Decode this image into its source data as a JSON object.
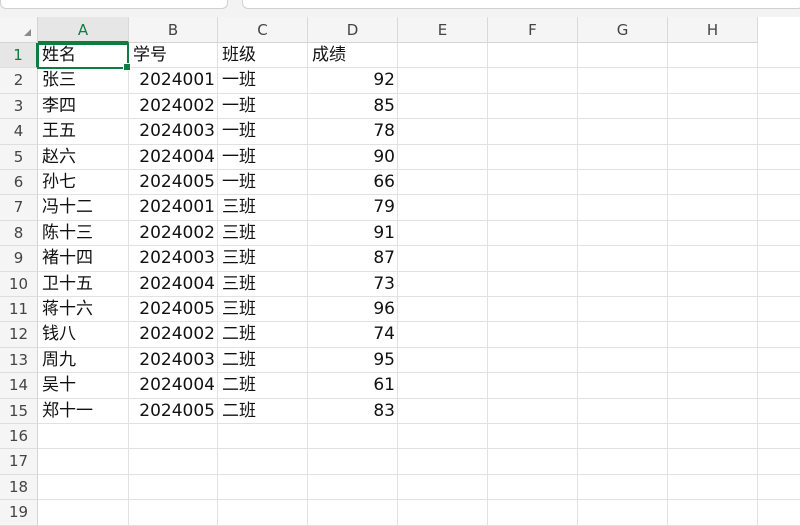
{
  "columns": [
    "A",
    "B",
    "C",
    "D",
    "E",
    "F",
    "G",
    "H"
  ],
  "rows": [
    "1",
    "2",
    "3",
    "4",
    "5",
    "6",
    "7",
    "8",
    "9",
    "10",
    "11",
    "12",
    "13",
    "14",
    "15",
    "16",
    "17",
    "18",
    "19"
  ],
  "selected_cell": "A1",
  "accent_color": "#107c41",
  "cells": [
    [
      "姓名",
      "学号",
      "班级",
      "成绩"
    ],
    [
      "张三",
      "2024001",
      "一班",
      "92"
    ],
    [
      "李四",
      "2024002",
      "一班",
      "85"
    ],
    [
      "王五",
      "2024003",
      "一班",
      "78"
    ],
    [
      "赵六",
      "2024004",
      "一班",
      "90"
    ],
    [
      "孙七",
      "2024005",
      "一班",
      "66"
    ],
    [
      "冯十二",
      "2024001",
      "三班",
      "79"
    ],
    [
      "陈十三",
      "2024002",
      "三班",
      "91"
    ],
    [
      "褚十四",
      "2024003",
      "三班",
      "87"
    ],
    [
      "卫十五",
      "2024004",
      "三班",
      "73"
    ],
    [
      "蒋十六",
      "2024005",
      "三班",
      "96"
    ],
    [
      "钱八",
      "2024002",
      "二班",
      "74"
    ],
    [
      "周九",
      "2024003",
      "二班",
      "95"
    ],
    [
      "吴十",
      "2024004",
      "二班",
      "61"
    ],
    [
      "郑十一",
      "2024005",
      "二班",
      "83"
    ]
  ]
}
